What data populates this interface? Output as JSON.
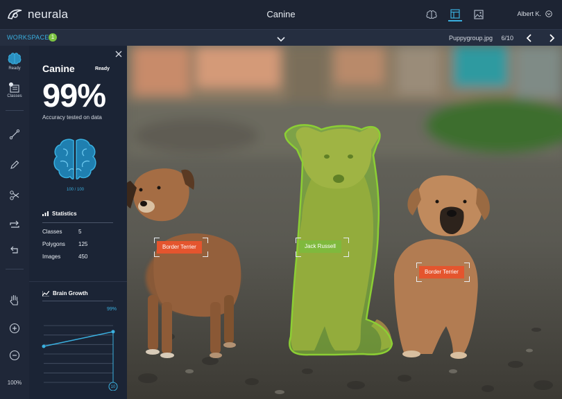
{
  "app": {
    "logo_text": "neurala",
    "title": "Canine",
    "user_name": "Albert K."
  },
  "icons": {
    "brain_top": "brain-icon",
    "layout": "layout-icon",
    "gallery": "image-gallery-icon",
    "user_chevron": "chevron-down-icon"
  },
  "workspace": {
    "label": "WORKSPACE",
    "badge": "1",
    "filename": "Puppygroup.jpg",
    "counter": "6/10"
  },
  "toolbar": {
    "ready_label": "Ready",
    "classes_label": "Classes",
    "zoom": "100%"
  },
  "panel": {
    "title": "Canine",
    "status": "Ready",
    "accuracy": "99%",
    "accuracy_label": "Accuracy tested on data",
    "brain_count": "100 / 100",
    "stats_heading": "Statistics",
    "stats": [
      {
        "label": "Classes",
        "value": "5"
      },
      {
        "label": "Polygons",
        "value": "125"
      },
      {
        "label": "Images",
        "value": "450"
      }
    ],
    "growth_heading": "Brain Growth",
    "growth_value": "99%",
    "growth_end_marker": "10"
  },
  "chart_data": {
    "type": "line",
    "title": "Brain Growth",
    "series": [
      {
        "values": [
          70,
          99
        ]
      }
    ],
    "end_label": "99%",
    "end_marker": "10"
  },
  "labels": [
    {
      "text": "Border Terrier",
      "color": "#e4552e"
    },
    {
      "text": "Jack Russell",
      "color": "#7fb93d"
    },
    {
      "text": "Border Terrier",
      "color": "#e4552e"
    }
  ],
  "colors": {
    "accent": "#3ab0e0",
    "ready_green": "#7cc242",
    "label_orange": "#e4552e",
    "label_green": "#7fb93d"
  }
}
